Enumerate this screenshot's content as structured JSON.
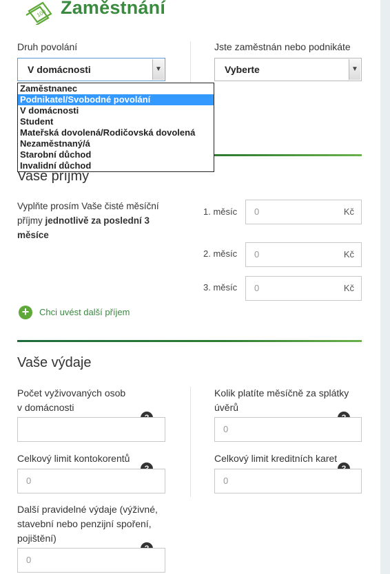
{
  "header": {
    "title": "Zaměstnání",
    "logo_icon": "money-card-icon"
  },
  "employment": {
    "occupation_label": "Druh povolání",
    "occupation_value": "V domácnosti",
    "employed_label": "Jste zaměstnán nebo podnikáte",
    "employed_value": "Vyberte",
    "options": [
      "Zaměstnanec",
      "Podnikatel/Svobodné povolání",
      "V domácnosti",
      "Student",
      "Mateřská dovolená/Rodičovská dovolená",
      "Nezaměstnaný/á",
      "Starobní důchod",
      "Invalidní důchod"
    ],
    "highlighted_option_index": 1
  },
  "income": {
    "heading": "Vaše příjmy",
    "desc_line1": "Vyplňte prosím Vaše čisté měsíční",
    "desc_line2_plain": "příjmy ",
    "desc_line2_bold": "jednotlivě za poslední 3",
    "desc_line3_bold": "měsíce",
    "months": [
      {
        "label": "1. měsíc",
        "value": "0",
        "unit": "Kč"
      },
      {
        "label": "2. měsíc",
        "value": "0",
        "unit": "Kč"
      },
      {
        "label": "3. měsíc",
        "value": "0",
        "unit": "Kč"
      }
    ],
    "add_link": "Chci uvést další příjem"
  },
  "expenses": {
    "heading": "Vaše výdaje",
    "dependents_label_line1": "Počet vyživovaných osob",
    "dependents_label_line2": "v domácnosti",
    "dependents_value": "",
    "loans_label_line1": "Kolik platíte měsíčně za splátky",
    "loans_label_line2": "úvěrů",
    "loans_value": "0",
    "overdraft_label": "Celkový limit kontokorentů",
    "overdraft_value": "0",
    "credit_label": "Celkový limit kreditních karet",
    "credit_value": "0",
    "other_label_line1": "Další pravidelné výdaje (výživné,",
    "other_label_line2": "stavební nebo penzijní spoření,",
    "other_label_line3": "pojištění)",
    "other_value": "0",
    "help_symbol": "?"
  },
  "colors": {
    "accent_green": "#3a8a3f",
    "highlight_blue": "#3399ff"
  }
}
